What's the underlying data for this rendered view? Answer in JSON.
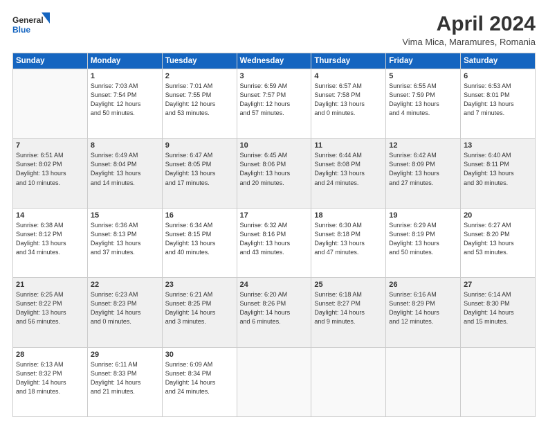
{
  "logo": {
    "line1": "General",
    "line2": "Blue"
  },
  "title": "April 2024",
  "subtitle": "Vima Mica, Maramures, Romania",
  "days_of_week": [
    "Sunday",
    "Monday",
    "Tuesday",
    "Wednesday",
    "Thursday",
    "Friday",
    "Saturday"
  ],
  "weeks": [
    [
      {
        "day": "",
        "info": ""
      },
      {
        "day": "1",
        "info": "Sunrise: 7:03 AM\nSunset: 7:54 PM\nDaylight: 12 hours\nand 50 minutes."
      },
      {
        "day": "2",
        "info": "Sunrise: 7:01 AM\nSunset: 7:55 PM\nDaylight: 12 hours\nand 53 minutes."
      },
      {
        "day": "3",
        "info": "Sunrise: 6:59 AM\nSunset: 7:57 PM\nDaylight: 12 hours\nand 57 minutes."
      },
      {
        "day": "4",
        "info": "Sunrise: 6:57 AM\nSunset: 7:58 PM\nDaylight: 13 hours\nand 0 minutes."
      },
      {
        "day": "5",
        "info": "Sunrise: 6:55 AM\nSunset: 7:59 PM\nDaylight: 13 hours\nand 4 minutes."
      },
      {
        "day": "6",
        "info": "Sunrise: 6:53 AM\nSunset: 8:01 PM\nDaylight: 13 hours\nand 7 minutes."
      }
    ],
    [
      {
        "day": "7",
        "info": "Sunrise: 6:51 AM\nSunset: 8:02 PM\nDaylight: 13 hours\nand 10 minutes."
      },
      {
        "day": "8",
        "info": "Sunrise: 6:49 AM\nSunset: 8:04 PM\nDaylight: 13 hours\nand 14 minutes."
      },
      {
        "day": "9",
        "info": "Sunrise: 6:47 AM\nSunset: 8:05 PM\nDaylight: 13 hours\nand 17 minutes."
      },
      {
        "day": "10",
        "info": "Sunrise: 6:45 AM\nSunset: 8:06 PM\nDaylight: 13 hours\nand 20 minutes."
      },
      {
        "day": "11",
        "info": "Sunrise: 6:44 AM\nSunset: 8:08 PM\nDaylight: 13 hours\nand 24 minutes."
      },
      {
        "day": "12",
        "info": "Sunrise: 6:42 AM\nSunset: 8:09 PM\nDaylight: 13 hours\nand 27 minutes."
      },
      {
        "day": "13",
        "info": "Sunrise: 6:40 AM\nSunset: 8:11 PM\nDaylight: 13 hours\nand 30 minutes."
      }
    ],
    [
      {
        "day": "14",
        "info": "Sunrise: 6:38 AM\nSunset: 8:12 PM\nDaylight: 13 hours\nand 34 minutes."
      },
      {
        "day": "15",
        "info": "Sunrise: 6:36 AM\nSunset: 8:13 PM\nDaylight: 13 hours\nand 37 minutes."
      },
      {
        "day": "16",
        "info": "Sunrise: 6:34 AM\nSunset: 8:15 PM\nDaylight: 13 hours\nand 40 minutes."
      },
      {
        "day": "17",
        "info": "Sunrise: 6:32 AM\nSunset: 8:16 PM\nDaylight: 13 hours\nand 43 minutes."
      },
      {
        "day": "18",
        "info": "Sunrise: 6:30 AM\nSunset: 8:18 PM\nDaylight: 13 hours\nand 47 minutes."
      },
      {
        "day": "19",
        "info": "Sunrise: 6:29 AM\nSunset: 8:19 PM\nDaylight: 13 hours\nand 50 minutes."
      },
      {
        "day": "20",
        "info": "Sunrise: 6:27 AM\nSunset: 8:20 PM\nDaylight: 13 hours\nand 53 minutes."
      }
    ],
    [
      {
        "day": "21",
        "info": "Sunrise: 6:25 AM\nSunset: 8:22 PM\nDaylight: 13 hours\nand 56 minutes."
      },
      {
        "day": "22",
        "info": "Sunrise: 6:23 AM\nSunset: 8:23 PM\nDaylight: 14 hours\nand 0 minutes."
      },
      {
        "day": "23",
        "info": "Sunrise: 6:21 AM\nSunset: 8:25 PM\nDaylight: 14 hours\nand 3 minutes."
      },
      {
        "day": "24",
        "info": "Sunrise: 6:20 AM\nSunset: 8:26 PM\nDaylight: 14 hours\nand 6 minutes."
      },
      {
        "day": "25",
        "info": "Sunrise: 6:18 AM\nSunset: 8:27 PM\nDaylight: 14 hours\nand 9 minutes."
      },
      {
        "day": "26",
        "info": "Sunrise: 6:16 AM\nSunset: 8:29 PM\nDaylight: 14 hours\nand 12 minutes."
      },
      {
        "day": "27",
        "info": "Sunrise: 6:14 AM\nSunset: 8:30 PM\nDaylight: 14 hours\nand 15 minutes."
      }
    ],
    [
      {
        "day": "28",
        "info": "Sunrise: 6:13 AM\nSunset: 8:32 PM\nDaylight: 14 hours\nand 18 minutes."
      },
      {
        "day": "29",
        "info": "Sunrise: 6:11 AM\nSunset: 8:33 PM\nDaylight: 14 hours\nand 21 minutes."
      },
      {
        "day": "30",
        "info": "Sunrise: 6:09 AM\nSunset: 8:34 PM\nDaylight: 14 hours\nand 24 minutes."
      },
      {
        "day": "",
        "info": ""
      },
      {
        "day": "",
        "info": ""
      },
      {
        "day": "",
        "info": ""
      },
      {
        "day": "",
        "info": ""
      }
    ]
  ]
}
